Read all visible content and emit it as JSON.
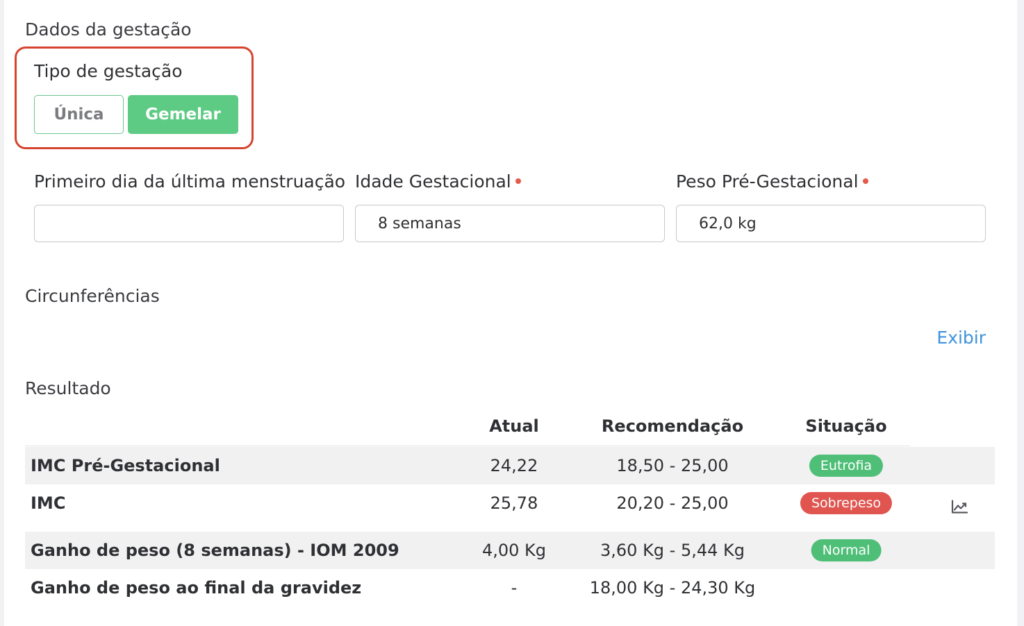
{
  "sections": {
    "pregnancy_data": "Dados da gestação",
    "circumferences": "Circunferências",
    "result": "Resultado"
  },
  "pregnancy_type": {
    "label": "Tipo de gestação",
    "options": [
      "Única",
      "Gemelar"
    ],
    "selected": "Gemelar"
  },
  "fields": {
    "last_period": {
      "label": "Primeiro dia da última menstruação",
      "value": ""
    },
    "gestational_age": {
      "label": "Idade Gestacional",
      "value": "8 semanas",
      "required": true
    },
    "pre_weight": {
      "label": "Peso Pré-Gestacional",
      "value": "62,0 kg",
      "required": true
    }
  },
  "circumferences_link": "Exibir",
  "table": {
    "headers": {
      "current": "Atual",
      "recommendation": "Recomendação",
      "status": "Situação"
    },
    "rows": [
      {
        "name": "IMC Pré-Gestacional",
        "current": "24,22",
        "recommendation": "18,50 - 25,00",
        "status": "Eutrofia",
        "status_color": "#4fbf78"
      },
      {
        "name": "IMC",
        "current": "25,78",
        "recommendation": "20,20 - 25,00",
        "status": "Sobrepeso",
        "status_color": "#e05550",
        "icon": "line-chart-icon"
      },
      {
        "name": "Ganho de peso (8 semanas) - IOM 2009",
        "current": "4,00 Kg",
        "recommendation": "3,60 Kg - 5,44 Kg",
        "status": "Normal",
        "status_color": "#4fbf78"
      },
      {
        "name": "Ganho de peso ao final da gravidez",
        "current": "-",
        "recommendation": "18,00 Kg - 24,30 Kg",
        "status": ""
      }
    ]
  },
  "colors": {
    "accent_green": "#5ecb85",
    "link_blue": "#3d93dc",
    "highlight_red": "#d6442f",
    "required_dot": "#e45a4a"
  }
}
